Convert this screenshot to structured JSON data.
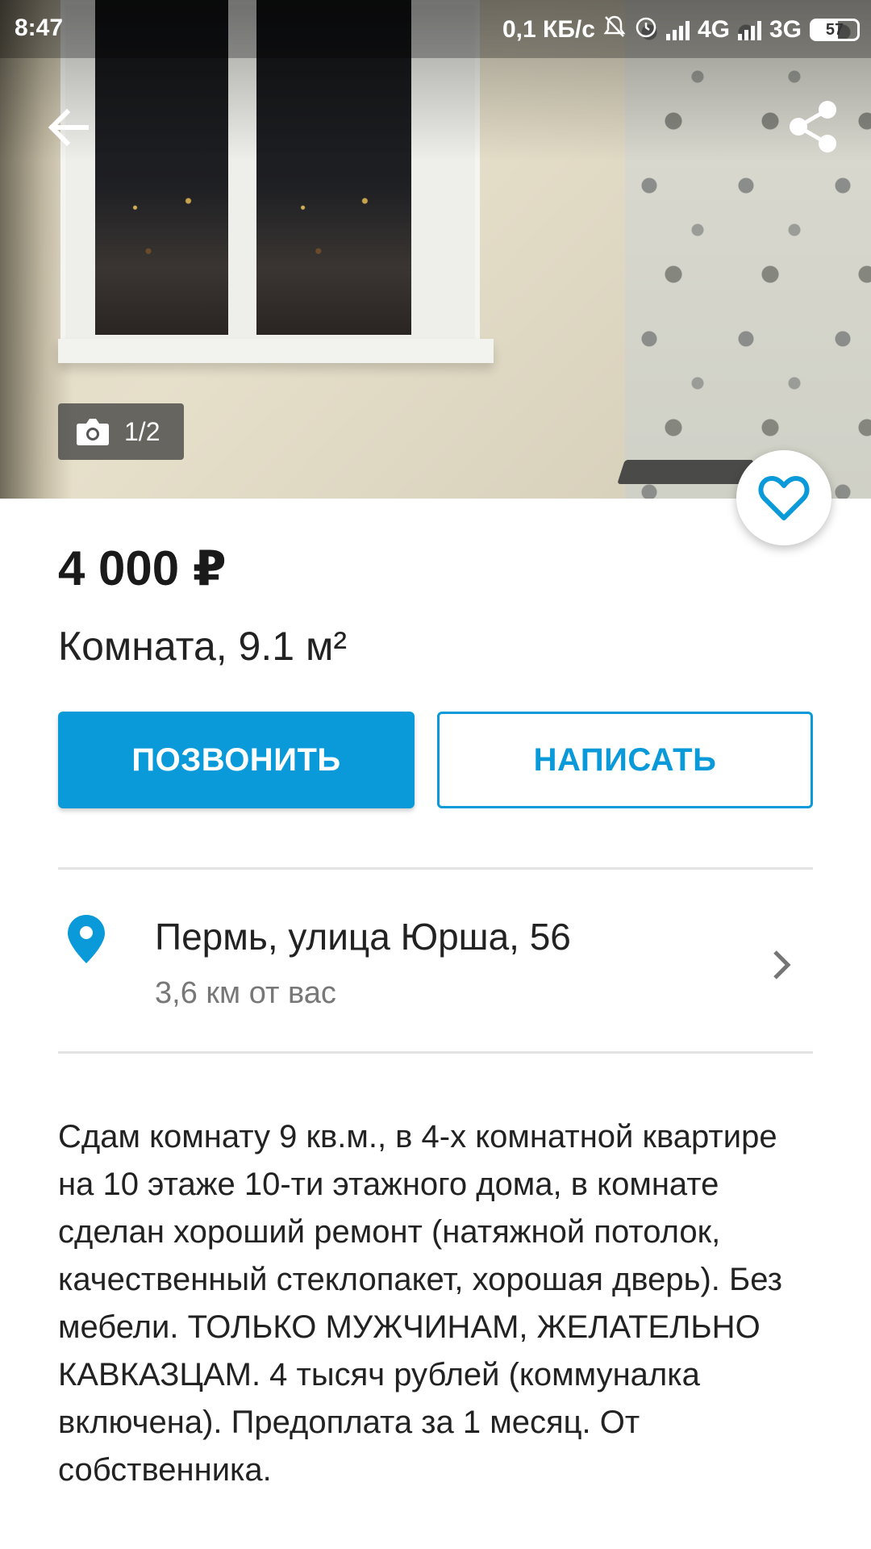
{
  "status_bar": {
    "time": "8:47",
    "speed": "0,1 КБ/с",
    "network_1": "4G",
    "network_2": "3G",
    "battery": "57"
  },
  "gallery": {
    "counter": "1/2",
    "camera_icon": "camera-icon",
    "back_icon": "arrow-left-icon",
    "share_icon": "share-icon",
    "favorite_icon": "heart-outline-icon"
  },
  "listing": {
    "price": "4 000 ₽",
    "title": "Комната, 9.1 м²"
  },
  "actions": {
    "call_label": "ПОЗВОНИТЬ",
    "write_label": "НАПИСАТЬ"
  },
  "location": {
    "address": "Пермь, улица Юрша, 56",
    "distance": "3,6 км от вас"
  },
  "description": "Сдам комнату 9 кв.м., в 4-х комнатной квартире на 10 этаже 10-ти этажного дома, в комнате сделан хороший ремонт (натяжной потолок, качественный стеклопакет, хорошая дверь). Без мебели. ТОЛЬКО МУЖЧИНАМ, ЖЕЛАТЕЛЬНО КАВКАЗЦАМ. 4 тысяч рублей (коммуналка включена). Предоплата за 1 месяц. От собственника.",
  "colors": {
    "accent": "#0a9ad9",
    "text": "#222222",
    "muted": "#777777",
    "divider": "#e3e3e3"
  }
}
